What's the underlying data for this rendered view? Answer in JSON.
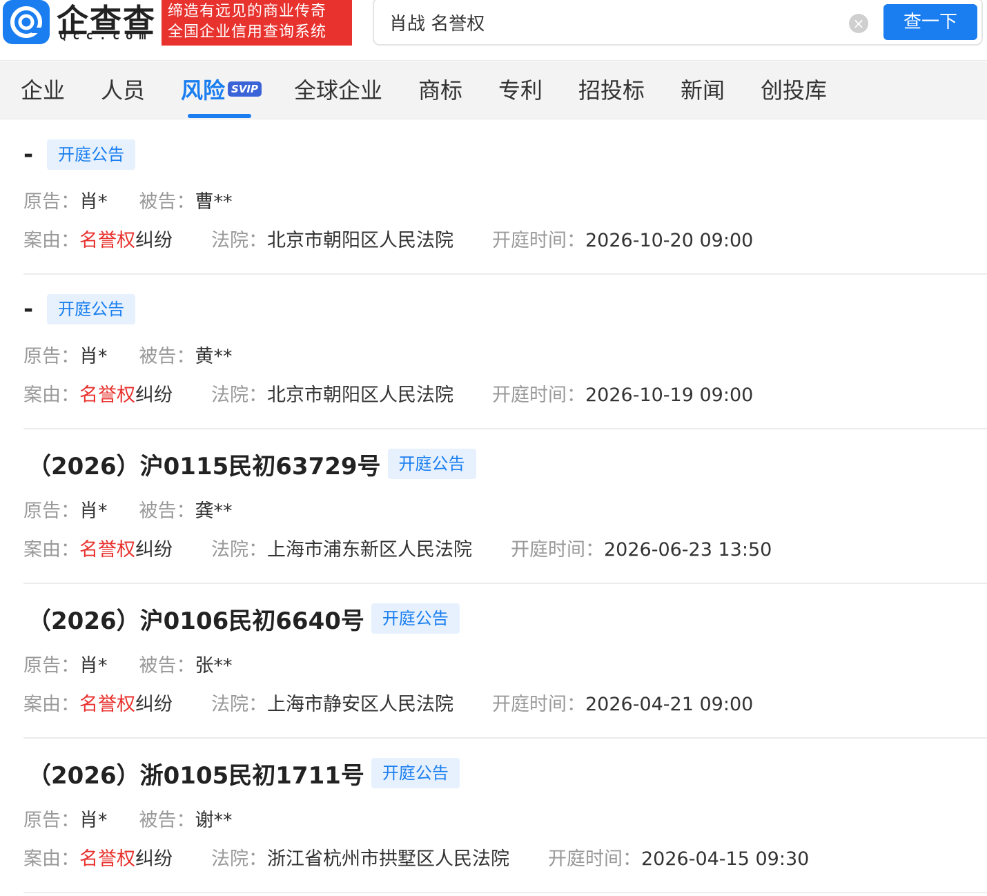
{
  "brand": {
    "logo_text": "企查查",
    "logo_sub": "Qcc.com",
    "slogan_line1": "缔造有远见的商业传奇",
    "slogan_line2": "全国企业信用查询系统"
  },
  "search": {
    "query": "肖战 名誉权",
    "clear_label": "×",
    "button_label": "查一下"
  },
  "nav": {
    "items": [
      "企业",
      "人员",
      "风险",
      "全球企业",
      "商标",
      "专利",
      "招投标",
      "新闻",
      "创投库"
    ],
    "active": "风险",
    "svip_badge": "SVIP"
  },
  "labels": {
    "plaintiff": "原告：",
    "defendant": "被告：",
    "cause": "案由：",
    "court": "法院：",
    "hearing_time": "开庭时间："
  },
  "records": [
    {
      "case_no": "-",
      "badge": "开庭公告",
      "plaintiff": "肖*",
      "defendant": "曹**",
      "cause_highlight": "名誉权",
      "cause_rest": "纠纷",
      "court": "北京市朝阳区人民法院",
      "time": "2026-10-20 09:00"
    },
    {
      "case_no": "-",
      "badge": "开庭公告",
      "plaintiff": "肖*",
      "defendant": "黄**",
      "cause_highlight": "名誉权",
      "cause_rest": "纠纷",
      "court": "北京市朝阳区人民法院",
      "time": "2026-10-19 09:00"
    },
    {
      "case_no": "（2026）沪0115民初63729号",
      "badge": "开庭公告",
      "plaintiff": "肖*",
      "defendant": "龚**",
      "cause_highlight": "名誉权",
      "cause_rest": "纠纷",
      "court": "上海市浦东新区人民法院",
      "time": "2026-06-23 13:50"
    },
    {
      "case_no": "（2026）沪0106民初6640号",
      "badge": "开庭公告",
      "plaintiff": "肖*",
      "defendant": "张**",
      "cause_highlight": "名誉权",
      "cause_rest": "纠纷",
      "court": "上海市静安区人民法院",
      "time": "2026-04-21 09:00"
    },
    {
      "case_no": "（2026）浙0105民初1711号",
      "badge": "开庭公告",
      "plaintiff": "肖*",
      "defendant": "谢**",
      "cause_highlight": "名誉权",
      "cause_rest": "纠纷",
      "court": "浙江省杭州市拱墅区人民法院",
      "time": "2026-04-15 09:30"
    }
  ],
  "colors": {
    "accent": "#1a7ef0",
    "highlight": "#e8322e",
    "badge_bg": "#e6f1fd"
  }
}
